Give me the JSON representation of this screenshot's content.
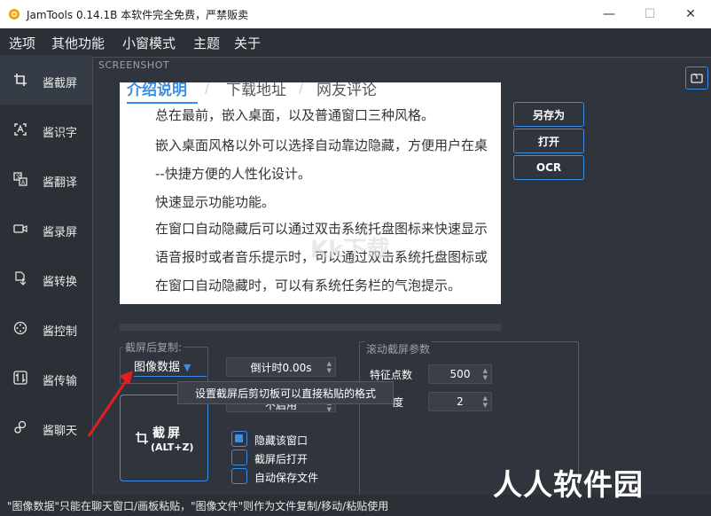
{
  "window": {
    "title": "JamTools 0.14.1B 本软件完全免费，严禁贩卖",
    "minimize": "—",
    "maximize": "☐",
    "close": "✕"
  },
  "menu": [
    "选项",
    "其他功能",
    "小窗模式",
    "主题",
    "关于"
  ],
  "sidebar": {
    "items": [
      {
        "label": "酱截屏",
        "icon": "crop-icon",
        "active": true
      },
      {
        "label": "酱识字",
        "icon": "text-recognition-icon"
      },
      {
        "label": "酱翻译",
        "icon": "translate-icon"
      },
      {
        "label": "酱录屏",
        "icon": "video-camera-icon"
      },
      {
        "label": "酱转换",
        "icon": "convert-icon"
      },
      {
        "label": "酱控制",
        "icon": "remote-control-icon"
      },
      {
        "label": "酱传输",
        "icon": "transfer-icon"
      },
      {
        "label": "酱聊天",
        "icon": "chat-icon"
      }
    ]
  },
  "panel": {
    "title": "SCREENSHOT"
  },
  "doc": {
    "tabs": [
      "介绍说明",
      "下载地址",
      "网友评论"
    ],
    "lines": [
      "总在最前，嵌入桌面，以及普通窗口三种风格。",
      "嵌入桌面风格以外可以选择自动靠边隐藏，方便用户在桌",
      "--快捷方便的人性化设计。",
      "快速显示功能功能。",
      "在窗口自动隐藏后可以通过双击系统托盘图标来快速显示",
      "语音报时或者音乐提示时，可以通过双击系统托盘图标或",
      "在窗口自动隐藏时，可以有系统任务栏的气泡提示。"
    ],
    "watermark": "Kk下载"
  },
  "actions": {
    "save_as": "另存为",
    "open": "打开",
    "ocr": "OCR"
  },
  "copy_group": {
    "title": "截屏后复制:",
    "selected": "图像数据",
    "arrow": "▼"
  },
  "countdown": {
    "value": "倒计时0.00s"
  },
  "hidden_spin": {
    "value": "不启用"
  },
  "capture_button": {
    "label": "截屏",
    "shortcut": "(ALT+Z)"
  },
  "checkboxes": [
    {
      "label": "隐藏该窗口",
      "checked": true
    },
    {
      "label": "截屏后打开",
      "checked": false
    },
    {
      "label": "自动保存文件",
      "checked": false
    }
  ],
  "scroll_group": {
    "title": "滚动截屏参数",
    "feature_points_label": "特征点数",
    "feature_points_value": "500",
    "precision_label": "度",
    "precision_value": "2"
  },
  "tooltip": "设置截屏后剪切板可以直接粘贴的格式",
  "status": "\"图像数据\"只能在聊天窗口/画板粘贴，\"图像文件\"则作为文件复制/移动/粘贴使用",
  "overlay_watermark": "人人软件园",
  "colors": {
    "accent": "#3a8ee6",
    "background": "#2b2f36",
    "annotation_arrow": "#e02020"
  }
}
